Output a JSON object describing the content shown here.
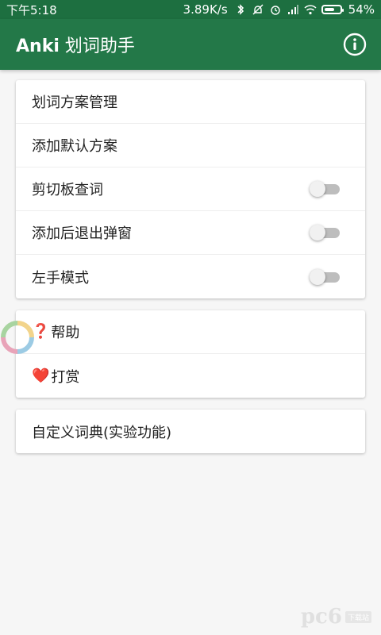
{
  "status_bar": {
    "time": "下午5:18",
    "speed": "3.89K/s",
    "battery": "54%",
    "battery_level": 0.54
  },
  "app_bar": {
    "brand": "Anki",
    "title_rest": " 划词助手",
    "info_icon": "info-circle-icon"
  },
  "card1": {
    "items": [
      {
        "label": "划词方案管理"
      },
      {
        "label": "添加默认方案"
      },
      {
        "label": "剪切板查词",
        "toggle": false
      },
      {
        "label": "添加后退出弹窗",
        "toggle": false
      },
      {
        "label": "左手模式",
        "toggle": false
      }
    ]
  },
  "card2": {
    "items": [
      {
        "emoji": "❓",
        "label": "帮助"
      },
      {
        "emoji": "❤️",
        "label": "打赏"
      }
    ]
  },
  "card3": {
    "items": [
      {
        "label": "自定义词典(实验功能)"
      }
    ]
  },
  "watermark": {
    "logo": "pc6",
    "tag": "下载站"
  },
  "colors": {
    "status_bar": "#1d6f40",
    "app_bar": "#237848",
    "toggle_track_off": "#bdbdbd",
    "toggle_thumb_off": "#f1f1f1"
  }
}
